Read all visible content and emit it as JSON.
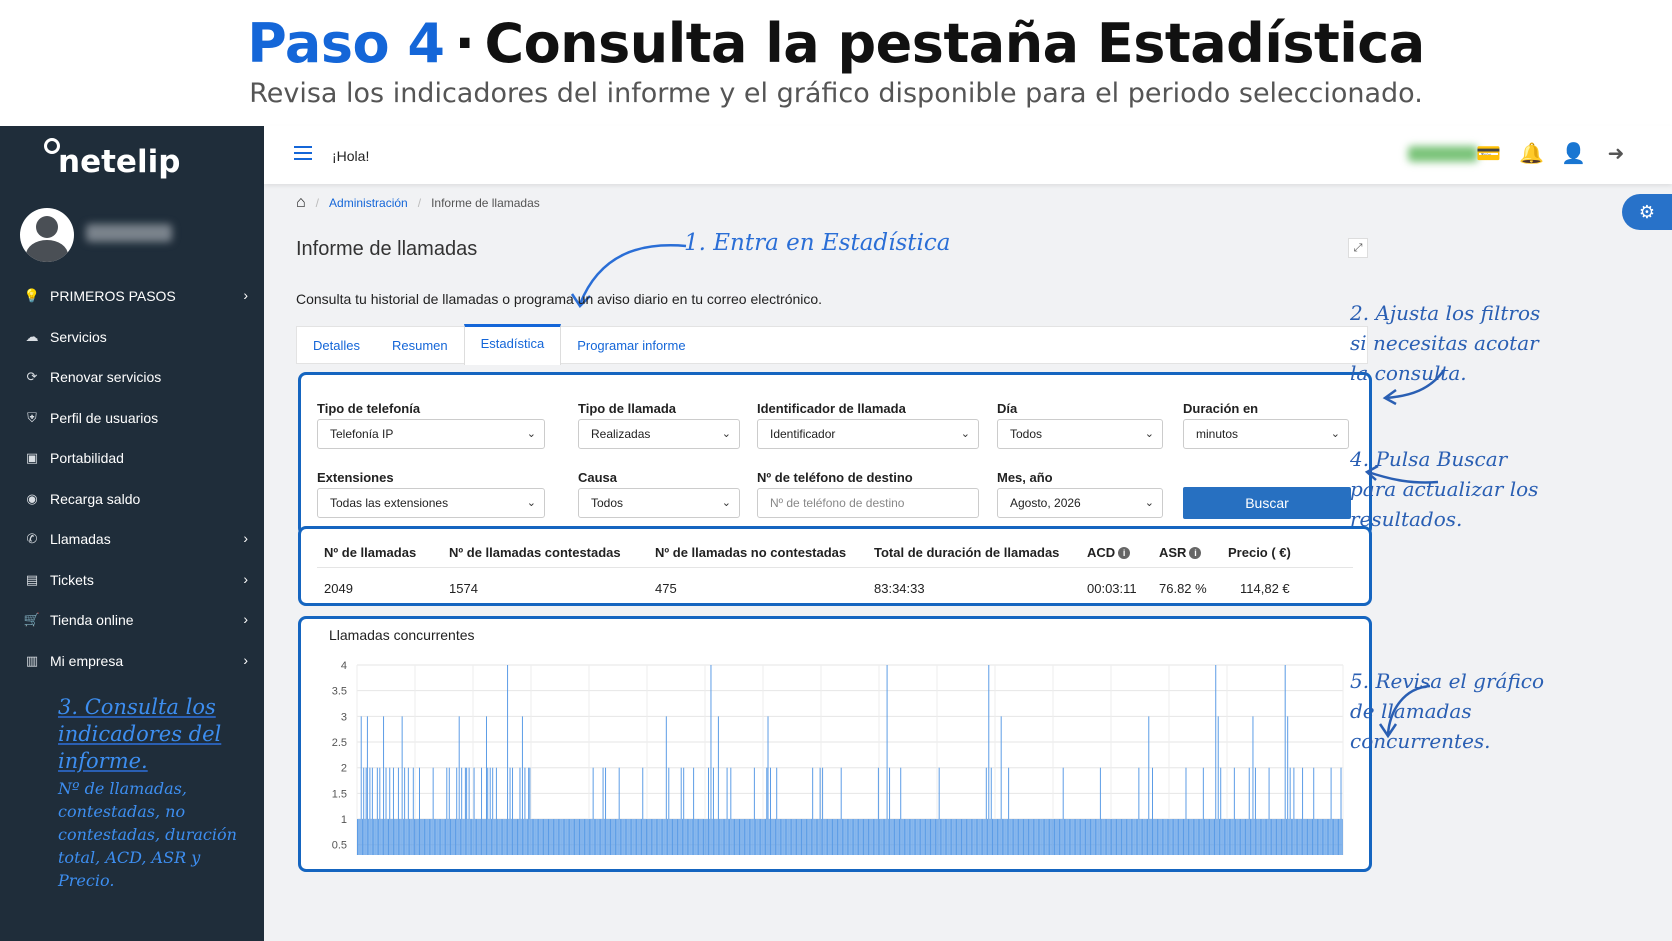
{
  "banner": {
    "step": "Paso 4",
    "separator": "·",
    "title_rest": "Consulta la pestaña Estadística",
    "subtitle": "Revisa los indicadores del informe y el gráfico disponible para el periodo seleccionado."
  },
  "sidebar": {
    "logo": "netelip",
    "items": [
      {
        "label": "PRIMEROS PASOS",
        "icon": "lightbulb-icon",
        "glyph": "💡",
        "chevron": true
      },
      {
        "label": "Servicios",
        "icon": "cloud-icon",
        "glyph": "☁",
        "chevron": false
      },
      {
        "label": "Renovar servicios",
        "icon": "renew-icon",
        "glyph": "⟳",
        "chevron": false
      },
      {
        "label": "Perfil de usuarios",
        "icon": "shield-icon",
        "glyph": "⛨",
        "chevron": false
      },
      {
        "label": "Portabilidad",
        "icon": "document-icon",
        "glyph": "▣",
        "chevron": false
      },
      {
        "label": "Recarga saldo",
        "icon": "wallet-icon",
        "glyph": "◉",
        "chevron": false
      },
      {
        "label": "Llamadas",
        "icon": "phone-icon",
        "glyph": "✆",
        "chevron": true
      },
      {
        "label": "Tickets",
        "icon": "ticket-icon",
        "glyph": "▤",
        "chevron": true
      },
      {
        "label": "Tienda online",
        "icon": "cart-icon",
        "glyph": "🛒",
        "chevron": true
      },
      {
        "label": "Mi empresa",
        "icon": "building-icon",
        "glyph": "▥",
        "chevron": true
      }
    ],
    "chevron": "›",
    "note_title": "3. Consulta los indicadores del informe.",
    "note_body": "Nº de llamadas, contestadas, no contestadas, duración total, ACD, ASR y Precio."
  },
  "topbar": {
    "greeting": "¡Hola!",
    "icons": {
      "card": "💳",
      "bell": "🔔",
      "user": "👤",
      "logout": "➜"
    },
    "settings_glyph": "⚙"
  },
  "breadcrumb": {
    "home_glyph": "⌂",
    "sep": "/",
    "items": [
      "Administración",
      "Informe de llamadas"
    ]
  },
  "page": {
    "title": "Informe de llamadas",
    "expand_glyph": "⤢",
    "description": "Consulta tu historial de llamadas o programa un aviso diario en tu correo electrónico.",
    "note1": "1. Entra en Estadística"
  },
  "tabs": [
    "Detalles",
    "Resumen",
    "Estadística",
    "Programar informe"
  ],
  "filters": {
    "tipo_telefonia": {
      "label": "Tipo de telefonía",
      "value": "Telefonía IP"
    },
    "tipo_llamada": {
      "label": "Tipo de llamada",
      "value": "Realizadas"
    },
    "identificador": {
      "label": "Identificador de llamada",
      "value": "Identificador"
    },
    "dia": {
      "label": "Día",
      "value": "Todos"
    },
    "duracion": {
      "label": "Duración en",
      "value": "minutos"
    },
    "extensiones": {
      "label": "Extensiones",
      "value": "Todas las extensiones"
    },
    "causa": {
      "label": "Causa",
      "value": "Todos"
    },
    "telefono_destino": {
      "label": "Nº de teléfono de destino",
      "placeholder": "Nº de teléfono de destino"
    },
    "mes_ano": {
      "label": "Mes, año",
      "value": "Agosto, 2026"
    },
    "search_button": "Buscar",
    "caret": "⌄"
  },
  "stats": {
    "headers": [
      "Nº de llamadas",
      "Nº de llamadas contestadas",
      "Nº de llamadas no contestadas",
      "Total de duración de llamadas",
      "ACD",
      "ASR",
      "Precio ( €)"
    ],
    "values": [
      "2049",
      "1574",
      "475",
      "83:34:33",
      "00:03:11",
      "76.82 %",
      "114,82 €"
    ],
    "info_glyph": "i"
  },
  "chart_data": {
    "type": "bar",
    "title": "Llamadas concurrentes",
    "ylim": [
      0.3,
      4
    ],
    "yticks": [
      "4",
      "3.5",
      "3",
      "2.5",
      "2",
      "1.5",
      "1",
      "0.5"
    ],
    "grid": true,
    "color": "#5b9ce6",
    "values": [
      1,
      1,
      1,
      3,
      1,
      2,
      1,
      2,
      3,
      1,
      2,
      1,
      2,
      1,
      1,
      1,
      2,
      1,
      2,
      1,
      1,
      3,
      1,
      2,
      1,
      1,
      2,
      1,
      1,
      2,
      1,
      1,
      1,
      2,
      1,
      1,
      3,
      1,
      2,
      1,
      1,
      2,
      1,
      1,
      1,
      2,
      1,
      1,
      1,
      1,
      2,
      1,
      1,
      1,
      1,
      1,
      1,
      1,
      1,
      1,
      1,
      2,
      1,
      1,
      1,
      1,
      1,
      1,
      1,
      1,
      1,
      1,
      2,
      1,
      2,
      1,
      1,
      1,
      1,
      1,
      2,
      1,
      3,
      1,
      2,
      1,
      1,
      2,
      2,
      1,
      2,
      1,
      1,
      1,
      2,
      1,
      1,
      1,
      1,
      1,
      2,
      1,
      1,
      1,
      3,
      2,
      1,
      2,
      1,
      2,
      1,
      1,
      2,
      1,
      1,
      1,
      1,
      1,
      1,
      1,
      1,
      4,
      1,
      2,
      1,
      2,
      1,
      1,
      1,
      1,
      1,
      2,
      1,
      3,
      1,
      2,
      1,
      1,
      2,
      2,
      1,
      1,
      1,
      1,
      1,
      1,
      1,
      1,
      1,
      1,
      1,
      1,
      1,
      1,
      1,
      1,
      1,
      1,
      1,
      1,
      1,
      1,
      1,
      1,
      1,
      1,
      1,
      1,
      1,
      1,
      1,
      1,
      1,
      1,
      1,
      1,
      1,
      1,
      1,
      1,
      1,
      1,
      1,
      1,
      1,
      1,
      1,
      1,
      1,
      1,
      2,
      1,
      1,
      1,
      1,
      1,
      1,
      1,
      2,
      1,
      2,
      1,
      1,
      1,
      1,
      1,
      1,
      1,
      1,
      1,
      1,
      2,
      1,
      1,
      1,
      1,
      1,
      1,
      1,
      1,
      1,
      1,
      1,
      1,
      1,
      1,
      1,
      1,
      1,
      1,
      2,
      1,
      1,
      1,
      1,
      1,
      1,
      1,
      1,
      1,
      1,
      1,
      1,
      1,
      1,
      1,
      1,
      1,
      1,
      3,
      1,
      2,
      1,
      1,
      1,
      1,
      1,
      1,
      1,
      1,
      1,
      2,
      1,
      2,
      1,
      1,
      1,
      1,
      1,
      1,
      1,
      2,
      1,
      1,
      1,
      1,
      1,
      1,
      1,
      1,
      1,
      1,
      1,
      2,
      1,
      4,
      1,
      2,
      1,
      1,
      1,
      3,
      1,
      1,
      1,
      1,
      1,
      1,
      2,
      1,
      1,
      2,
      1,
      1,
      1,
      1,
      1,
      1,
      1,
      1,
      1,
      1,
      1,
      1,
      1,
      1,
      1,
      1,
      1,
      1,
      2,
      1,
      1,
      1,
      1,
      1,
      1,
      1,
      1,
      1,
      2,
      3,
      1,
      2,
      1,
      1,
      1,
      1,
      2,
      1,
      1,
      1,
      1,
      1,
      1,
      1,
      1,
      1,
      1,
      1,
      1,
      1,
      1,
      1,
      1,
      1,
      1,
      1,
      1,
      1,
      1,
      1,
      1,
      1,
      1,
      1,
      1,
      2,
      1,
      1,
      1,
      1,
      1,
      2,
      1,
      2,
      1,
      1,
      1,
      1,
      1,
      1,
      1,
      1,
      1,
      1,
      1,
      1,
      1,
      1,
      2,
      1,
      1,
      1,
      1,
      1,
      1,
      1,
      1,
      1,
      1,
      1,
      1,
      1,
      1,
      1,
      1,
      1,
      1,
      1,
      1,
      1,
      1,
      1,
      1,
      1,
      1,
      1,
      1,
      1,
      2,
      1,
      1,
      1,
      1,
      1,
      1,
      4,
      1,
      2,
      1,
      1,
      1,
      1,
      1,
      1,
      1,
      1,
      2,
      1,
      1,
      1,
      1,
      1,
      1,
      1,
      1,
      1,
      1,
      1,
      1,
      1,
      1,
      1,
      1,
      1,
      1,
      1,
      1,
      1,
      1,
      1,
      1,
      1,
      1,
      1,
      1,
      1,
      1,
      2,
      1,
      1,
      1,
      1,
      1,
      1,
      1,
      1,
      1,
      1,
      1,
      1,
      1,
      1,
      1,
      1,
      1,
      1,
      1,
      1,
      1,
      1,
      1,
      1,
      1,
      1,
      1,
      1,
      1,
      1,
      1,
      1,
      1,
      1,
      1,
      1,
      1,
      2,
      1,
      4,
      1,
      2,
      1,
      1,
      1,
      1,
      1,
      1,
      1,
      3,
      1,
      1,
      1,
      1,
      1,
      2,
      1,
      1,
      1,
      1,
      1,
      1,
      1,
      1,
      1,
      1,
      1,
      1,
      1,
      1,
      1,
      1,
      1,
      1,
      1,
      1,
      1,
      1,
      1,
      1,
      1,
      1,
      1,
      1,
      1,
      1,
      1,
      1,
      1,
      1,
      1,
      1,
      1,
      1,
      1,
      1,
      1,
      1,
      1,
      2,
      1,
      1,
      1,
      1,
      1,
      1,
      1,
      1,
      1,
      1,
      1,
      1,
      1,
      1,
      1,
      1,
      1,
      1,
      1,
      1,
      1,
      1,
      1,
      1,
      1,
      1,
      1,
      1,
      1,
      2,
      1,
      1,
      1,
      1,
      1,
      1,
      1,
      1,
      1,
      1,
      1,
      1,
      1,
      1,
      1,
      1,
      1,
      1,
      1,
      1,
      1,
      1,
      1,
      1,
      1,
      1,
      1,
      1,
      1,
      1,
      2,
      1,
      1,
      1,
      1,
      1,
      1,
      1,
      3,
      1,
      1,
      2,
      1,
      1,
      1,
      1,
      1,
      1,
      1,
      1,
      1,
      1,
      1,
      1,
      1,
      1,
      1,
      1,
      1,
      1,
      1,
      1,
      1,
      1,
      1,
      1,
      1,
      1,
      2,
      1,
      1,
      1,
      1,
      1,
      1,
      1,
      1,
      1,
      1,
      1,
      1,
      1,
      2,
      1,
      1,
      1,
      1,
      1,
      1,
      1,
      1,
      1,
      4,
      1,
      3,
      1,
      2,
      1,
      1,
      1,
      1,
      1,
      1,
      1,
      1,
      1,
      1,
      2,
      1,
      1,
      1,
      1,
      1,
      1,
      1,
      1,
      1,
      1,
      1,
      2,
      1,
      1,
      3,
      1,
      2,
      1,
      1,
      1,
      1,
      1,
      1,
      1,
      1,
      1,
      1,
      2,
      1,
      1,
      1,
      1,
      1,
      1,
      1,
      1,
      1,
      1,
      1,
      1,
      4,
      1,
      3,
      1,
      2,
      1,
      1,
      2,
      1,
      1,
      1,
      1,
      1,
      1,
      2,
      1,
      1,
      1,
      1,
      1,
      1,
      1,
      1,
      2,
      1,
      1,
      1,
      1,
      1,
      1,
      1,
      1,
      1,
      1,
      1,
      1,
      1,
      2,
      1,
      1,
      1,
      1,
      1,
      1,
      1,
      2,
      1
    ]
  },
  "annotations": {
    "note2": "2. Ajusta los filtros si necesitas acotar la consulta.",
    "note4": "4. Pulsa Buscar para actualizar los resultados.",
    "note5": "5. Revisa el gráfico de llamadas concurrentes."
  },
  "colors": {
    "accent": "#1466d8",
    "sidebar": "#1f2d3a",
    "highlight": "#1565c0",
    "button": "#2770c1"
  }
}
